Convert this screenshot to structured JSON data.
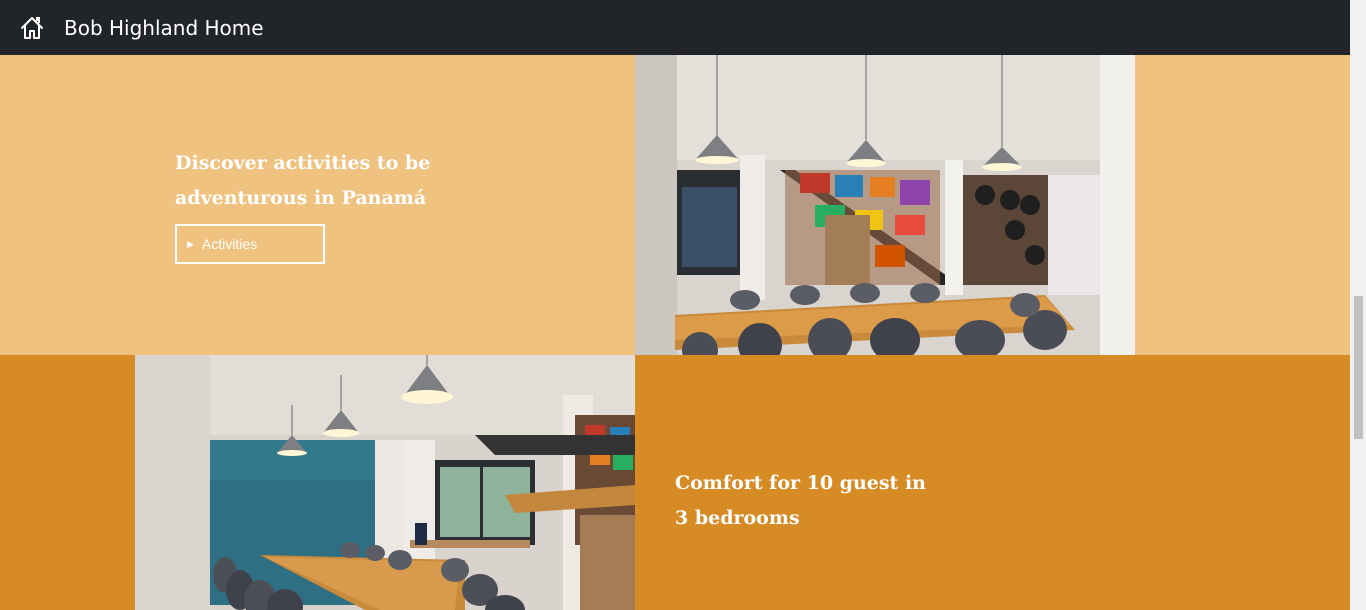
{
  "navbar": {
    "brand": "Bob Highland Home",
    "home_icon": "home-icon"
  },
  "sections": [
    {
      "headline": "Discover activities to be adventurous in Panamá",
      "button": {
        "label": "Activities",
        "icon": "play-icon"
      },
      "photo": "dining-room-with-pendant-lamps-and-staircase"
    },
    {
      "headline": "Comfort for 10 guest in 3 bedrooms",
      "photo": "dining-room-with-blue-wall-and-long-table"
    }
  ],
  "colors": {
    "navbar": "#212529",
    "section1_bg": "#f0c27f",
    "section2_bg": "#d68b25",
    "text": "#ffffff"
  }
}
